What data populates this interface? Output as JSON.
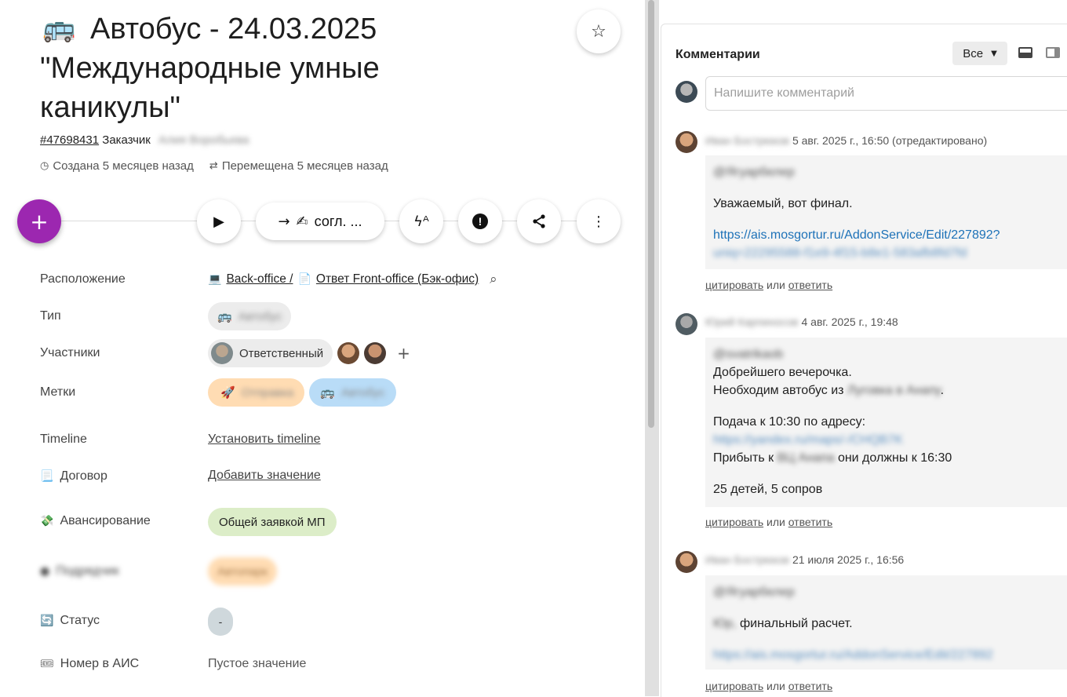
{
  "ticket": {
    "emoji": "🚌",
    "title_line1": "Автобус - 24.03.2025",
    "title_rest": "\"Международные умные каникулы\"",
    "id": "#47698431",
    "customer_label": "Заказчик",
    "customer_name": "Алия Воробьева",
    "created": "Создана 5 месяцев назад",
    "moved": "Перемещена 5 месяцев назад"
  },
  "toolbar": {
    "fab_label": "+",
    "status_button_label": "согл. ...",
    "status_button_emoji": "✍",
    "star_icon": "star-outline-icon"
  },
  "properties": {
    "location": {
      "label": "Расположение",
      "part1_emoji": "💻",
      "part1": "Back-office /",
      "part2_emoji": "📄",
      "part2": "Ответ Front-office (Бэк-офис)"
    },
    "type": {
      "label": "Тип",
      "emoji": "🚌",
      "value": "Автобус"
    },
    "members": {
      "label": "Участники",
      "responsible": "Ответственный"
    },
    "tags": {
      "label": "Метки",
      "tag1_emoji": "🚀",
      "tag1": "Отправка",
      "tag2_emoji": "🚌",
      "tag2": "Автобус"
    },
    "timeline": {
      "label": "Timeline",
      "action": "Установить timeline"
    },
    "contract": {
      "label": "Договор",
      "emoji": "📃",
      "action": "Добавить значение"
    },
    "advance": {
      "label": "Авансирование",
      "emoji": "💸",
      "value": "Общей заявкой МП"
    },
    "hidden_field": {
      "label": "Подрядчик",
      "value": "Автопарк"
    },
    "status": {
      "label": "Статус",
      "emoji": "🔄",
      "value": "-"
    },
    "ais_number": {
      "label": "Номер в АИС",
      "emoji": "🎟",
      "value": "Пустое значение"
    }
  },
  "comments": {
    "heading": "Комментарии",
    "filter": "Все",
    "input_placeholder": "Напишите комментарий",
    "quote": "цитировать",
    "or": "или",
    "reply": "ответить",
    "items": [
      {
        "author": "Иван Бострюков",
        "date": "5 авг. 2025 г., 16:50 (отредактировано)",
        "mention": "@Ягуарбелер",
        "line1": "Уважаемый, вот финал.",
        "link": "https://ais.mosgortur.ru/AddonService/Edit/227892?",
        "link_rest": "uniq=22295588-f1e9-4f15-b8e1-583afb8fd7fd"
      },
      {
        "author": "Юрий Карпиносов",
        "date": "4 авг. 2025 г., 19:48",
        "mention": "@svatrikaob",
        "line1": "Добрейшего вечерочка.",
        "line2_a": "Необходим автобус из",
        "line2_b": "Луговка в Анапу",
        "line2_c": ".",
        "line3": "Подача к 10:30 по адресу:",
        "link": "https://yandex.ru/maps/-/CHQB7K",
        "line4_a": "Прибыть к",
        "line4_b": "ВЦ Анапа",
        "line4_c": "они должны к 16:30",
        "line5": "25 детей, 5 сопров"
      },
      {
        "author": "Иван Бострюков",
        "date": "21 июля 2025 г., 16:56",
        "mention": "@Ягуарбелер",
        "line1_a": "Юр,",
        "line1_b": "финальный расчет.",
        "link": "https://ais.mosgortur.ru/AddonService/Edit/227892"
      }
    ]
  }
}
